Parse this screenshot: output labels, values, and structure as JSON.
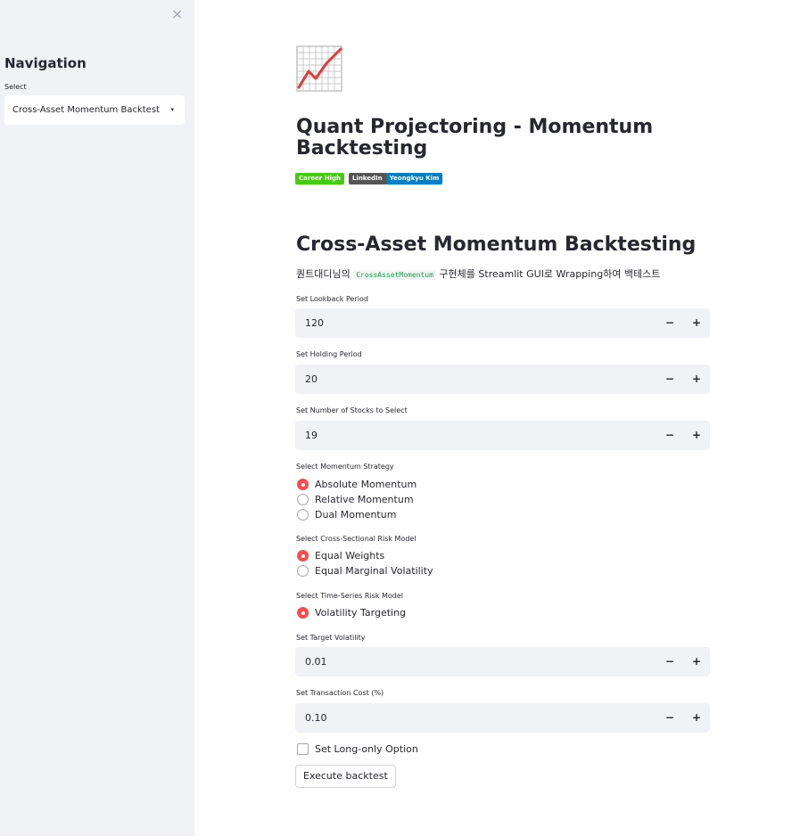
{
  "sidebar": {
    "close_icon": "×",
    "heading": "Navigation",
    "select_label": "Select",
    "select_value": "Cross-Asset Momentum Backtest",
    "caret": "▾"
  },
  "header": {
    "logo_icon": "chart-increasing-icon",
    "title": "Quant Projectoring - Momentum Backtesting",
    "badges": [
      {
        "parts": [
          "Career High"
        ],
        "colors": [
          "#44cc11"
        ]
      },
      {
        "parts": [
          "LinkedIn",
          "Yeongkyu Kim"
        ],
        "colors": [
          "#555555",
          "#007ec6"
        ]
      }
    ]
  },
  "main": {
    "heading": "Cross-Asset Momentum Backtesting",
    "desc_pre": "퀀트대디님의 ",
    "desc_code": "CrossAssetMomentum",
    "desc_post": " 구현체를 Streamlit GUI로 Wrapping하여 백테스트",
    "lookback": {
      "label": "Set Lookback Period",
      "value": "120"
    },
    "holding": {
      "label": "Set Holding Period",
      "value": "20"
    },
    "num_stocks": {
      "label": "Set Number of Stocks to Select",
      "value": "19"
    },
    "momentum_strategy": {
      "label": "Select Momentum Strategy",
      "options": [
        "Absolute Momentum",
        "Relative Momentum",
        "Dual Momentum"
      ],
      "selected": 0
    },
    "cs_risk_model": {
      "label": "Select Cross-Sectional Risk Model",
      "options": [
        "Equal Weights",
        "Equal Marginal Volatility"
      ],
      "selected": 0
    },
    "ts_risk_model": {
      "label": "Select Time-Series Risk Model",
      "options": [
        "Volatility Targeting"
      ],
      "selected": 0
    },
    "target_vol": {
      "label": "Set Target Volatility",
      "value": "0.01"
    },
    "txn_cost": {
      "label": "Set Transaction Cost (%)",
      "value": "0.10"
    },
    "long_only_label": "Set Long-only Option",
    "execute_label": "Execute backtest",
    "stepper_minus": "−",
    "stepper_plus": "+"
  },
  "colors": {
    "accent": "#ff4b4b",
    "sidebar_bg": "#f0f2f6",
    "code_green": "#09ab3b"
  }
}
